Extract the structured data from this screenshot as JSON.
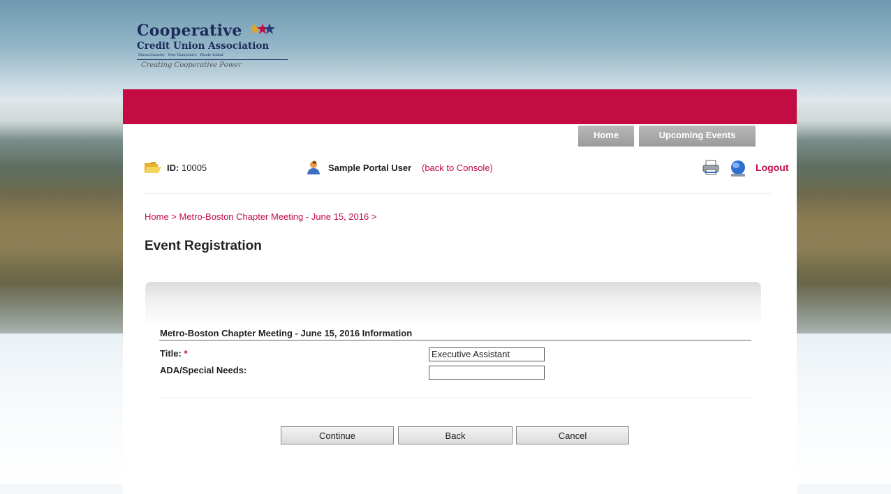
{
  "logo": {
    "name_line1": "Cooperative",
    "name_line2": "Credit Union Association",
    "states": "Massachusetts · New Hampshire · Rhode Island",
    "tagline": "Creating Cooperative Power"
  },
  "nav": {
    "tabs": [
      {
        "label": "Home"
      },
      {
        "label": "Upcoming Events"
      }
    ]
  },
  "info": {
    "id_label": "ID:",
    "id_value": "10005",
    "user_name": "Sample Portal User",
    "console_link": "(back to Console)",
    "logout": "Logout"
  },
  "breadcrumb": "Home > Metro-Boston Chapter Meeting - June 15, 2016 >",
  "page_title": "Event Registration",
  "form": {
    "section_title": "Metro-Boston Chapter Meeting - June 15, 2016 Information",
    "fields": [
      {
        "label": "Title:",
        "required_mark": "*",
        "value": "Executive Assistant"
      },
      {
        "label": "ADA/Special Needs:",
        "required_mark": "",
        "value": ""
      }
    ]
  },
  "buttons": {
    "continue": "Continue",
    "back": "Back",
    "cancel": "Cancel"
  },
  "colors": {
    "brand_red": "#c30c43",
    "navy": "#1d2a5a",
    "tab_gray": "#a6a6a6"
  },
  "icons": [
    "folder-icon",
    "user-icon",
    "printer-icon",
    "globe-icon",
    "stars-icon"
  ]
}
